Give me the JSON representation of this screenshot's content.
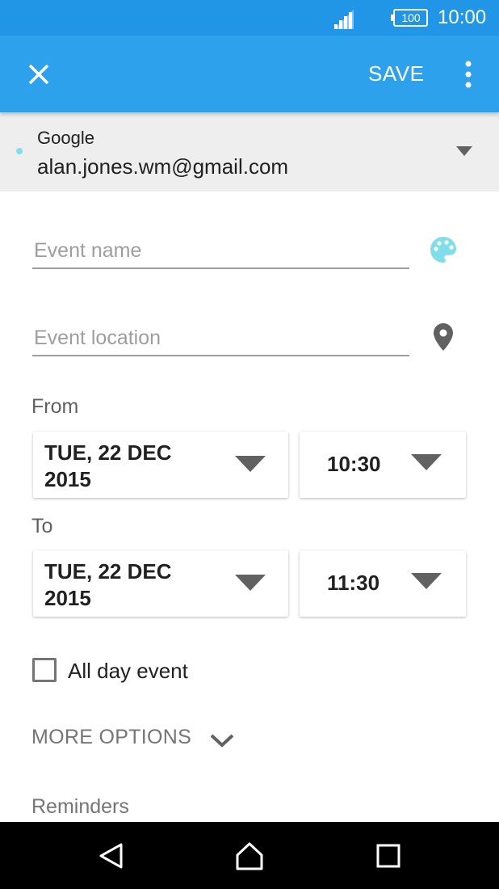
{
  "status_bar": {
    "battery_level": "100",
    "time": "10:00",
    "icons": [
      "signal-icon",
      "battery-icon"
    ]
  },
  "app_bar": {
    "close_icon": "close-icon",
    "save_label": "SAVE",
    "menu_icon": "more-vert-icon",
    "background_color": "#2ea1ec"
  },
  "account": {
    "provider": "Google",
    "email": "alan.jones.wm@gmail.com",
    "dot_color": "#80deea",
    "dropdown_icon": "dropdown-arrow-icon"
  },
  "form": {
    "event_name_placeholder": "Event name",
    "event_name_value": "",
    "event_location_placeholder": "Event location",
    "event_location_value": "",
    "color_icon": "palette-icon",
    "location_icon": "location-pin-icon",
    "from_label": "From",
    "from_date": "TUE, 22 DEC 2015",
    "from_time": "10:30",
    "to_label": "To",
    "to_date": "TUE, 22 DEC 2015",
    "to_time": "11:30",
    "all_day_label": "All day event",
    "all_day_checked": false,
    "more_options_label": "MORE OPTIONS",
    "reminders_label": "Reminders"
  },
  "nav_bar": {
    "icons": [
      "back-icon",
      "home-icon",
      "recent-apps-icon"
    ]
  }
}
